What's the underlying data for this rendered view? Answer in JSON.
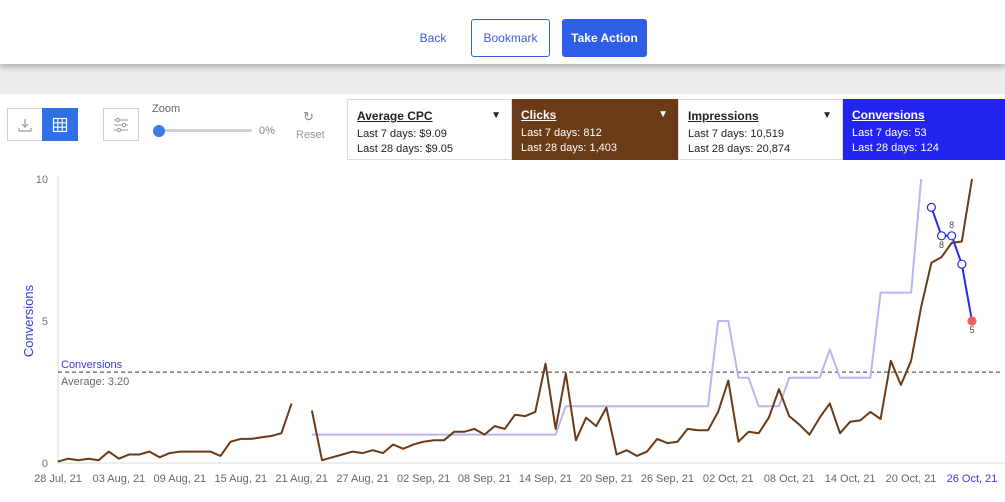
{
  "toolbar": {
    "back_label": "Back",
    "bookmark_label": "Bookmark",
    "action_label": "Take Action",
    "zoom_label": "Zoom",
    "zoom_value": "0%",
    "reset_label": "Reset"
  },
  "metrics": [
    {
      "name": "Average CPC",
      "line1": "Last 7 days: $9.09",
      "line2": "Last 28 days: $9.05",
      "color": "#ffffff"
    },
    {
      "name": "Clicks",
      "line1": "Last 7 days: 812",
      "line2": "Last 28 days: 1,403",
      "color": "#6b3a17"
    },
    {
      "name": "Impressions",
      "line1": "Last 7 days: 10,519",
      "line2": "Last 28 days: 20,874",
      "color": "#ffffff"
    },
    {
      "name": "Conversions",
      "line1": "Last 7 days: 53",
      "line2": "Last 28 days: 124",
      "color": "#2424f0"
    }
  ],
  "chart_data": {
    "type": "line",
    "ylabel": "Conversions",
    "ylim": [
      0,
      10
    ],
    "yticks": [
      "0",
      "5",
      "10"
    ],
    "x_tick_labels": [
      "28 Jul, 21",
      "03 Aug, 21",
      "09 Aug, 21",
      "15 Aug, 21",
      "21 Aug, 21",
      "27 Aug, 21",
      "02 Sep, 21",
      "08 Sep, 21",
      "14 Sep, 21",
      "20 Sep, 21",
      "26 Sep, 21",
      "02 Oct, 21",
      "08 Oct, 21",
      "14 Oct, 21",
      "20 Oct, 21",
      "26 Oct, 21"
    ],
    "highlighted_tick": "26 Oct, 21",
    "average": {
      "label": "Conversions",
      "text": "Average: 3.20",
      "value": 3.2
    },
    "series": [
      {
        "name": "Clicks",
        "color": "#6b3a17",
        "scaled_values": [
          0.05,
          0.15,
          0.1,
          0.15,
          0.1,
          0.4,
          0.15,
          0.3,
          0.3,
          0.4,
          0.2,
          0.35,
          0.4,
          0.4,
          0.4,
          0.4,
          0.25,
          0.75,
          0.85,
          0.85,
          0.9,
          0.95,
          1.05,
          2.1,
          null,
          1.85,
          0.1,
          0.2,
          0.3,
          0.4,
          0.35,
          0.45,
          0.35,
          0.65,
          0.5,
          0.65,
          0.75,
          0.8,
          0.8,
          1.1,
          1.1,
          1.2,
          1.0,
          1.3,
          1.2,
          1.7,
          1.65,
          1.8,
          3.5,
          1.2,
          3.15,
          0.8,
          1.6,
          1.3,
          1.95,
          0.3,
          0.45,
          0.25,
          0.4,
          0.85,
          0.7,
          0.75,
          1.2,
          1.15,
          1.15,
          1.8,
          2.9,
          0.75,
          1.1,
          1.05,
          1.6,
          2.6,
          1.65,
          1.35,
          1.0,
          1.6,
          2.1,
          1.05,
          1.45,
          1.5,
          1.8,
          1.55,
          3.6,
          2.75,
          3.6,
          5.5,
          7.05,
          7.25,
          7.75,
          7.8,
          10.0
        ]
      },
      {
        "name": "Impressions",
        "color": "#b9b6f0",
        "scaled_values": [
          null,
          null,
          null,
          null,
          null,
          null,
          null,
          null,
          null,
          null,
          null,
          null,
          null,
          null,
          null,
          null,
          null,
          null,
          null,
          null,
          null,
          null,
          null,
          null,
          null,
          1.0,
          1.0,
          1.0,
          1.0,
          1.0,
          1.0,
          1.0,
          1.0,
          1.0,
          1.0,
          1.0,
          1.0,
          1.0,
          1.0,
          1.0,
          1.0,
          1.0,
          1.0,
          1.0,
          1.0,
          1.0,
          1.0,
          1.0,
          1.0,
          1.0,
          2.0,
          2.0,
          2.0,
          2.0,
          2.0,
          2.0,
          2.0,
          2.0,
          2.0,
          2.0,
          2.0,
          2.0,
          2.0,
          2.0,
          2.0,
          5.0,
          5.0,
          3.0,
          3.0,
          2.0,
          2.0,
          2.0,
          3.0,
          3.0,
          3.0,
          3.0,
          4.0,
          3.0,
          3.0,
          3.0,
          3.0,
          6.0,
          6.0,
          6.0,
          6.0,
          10.0,
          null,
          null,
          null,
          null,
          null
        ]
      },
      {
        "name": "Conversions",
        "color": "#2a2ae8",
        "marker_start": 86,
        "values": [
          9,
          8,
          8,
          7,
          5
        ],
        "point_labels": [
          "8",
          "8",
          "5"
        ]
      }
    ]
  }
}
